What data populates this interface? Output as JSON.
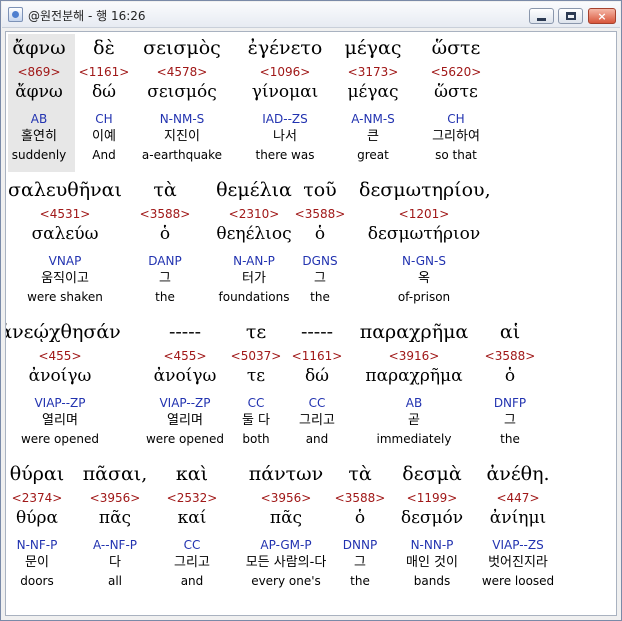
{
  "window": {
    "title": "@원전분해 - 행 16:26",
    "controls": {
      "minimize": "minimize",
      "maximize": "maximize",
      "close": "×"
    }
  },
  "verse": {
    "rows": [
      {
        "words": [
          {
            "word": "ἄφνω",
            "strong": "<869>",
            "lemma": "ἄφνω",
            "parse": "AB",
            "korean": "홀연히",
            "english": "suddenly"
          },
          {
            "word": "δὲ",
            "strong": "<1161>",
            "lemma": "δώ",
            "parse": "CH",
            "korean": "이예",
            "english": "And"
          },
          {
            "word": "σεισμὸς",
            "strong": "<4578>",
            "lemma": "σεισμός",
            "parse": "N-NM-S",
            "korean": "지진이",
            "english": "a-earthquake"
          },
          {
            "word": "ἐγένετο",
            "strong": "<1096>",
            "lemma": "γίνομαι",
            "parse": "IAD--ZS",
            "korean": "나서",
            "english": "there was"
          },
          {
            "word": "μέγας",
            "strong": "<3173>",
            "lemma": "μέγας",
            "parse": "A-NM-S",
            "korean": "큰",
            "english": "great"
          },
          {
            "word": "ὥστε",
            "strong": "<5620>",
            "lemma": "ὥστε",
            "parse": "CH",
            "korean": "그리하여",
            "english": "so that"
          }
        ]
      },
      {
        "words": [
          {
            "word": "σαλευθῆναι",
            "strong": "<4531>",
            "lemma": "σαλεύω",
            "parse": "VNAP",
            "korean": "움직이고",
            "english": "were shaken"
          },
          {
            "word": "τὰ",
            "strong": "<3588>",
            "lemma": "ὁ",
            "parse": "DANP",
            "korean": "그",
            "english": "the"
          },
          {
            "word": "θεμέλια",
            "strong": "<2310>",
            "lemma": "θεηέλιος",
            "parse": "N-AN-P",
            "korean": "터가",
            "english": "foundations"
          },
          {
            "word": "τοῦ",
            "strong": "<3588>",
            "lemma": "ὁ",
            "parse": "DGNS",
            "korean": "그",
            "english": "the"
          },
          {
            "word": "δεσμωτηρίου,",
            "strong": "<1201>",
            "lemma": "δεσμωτήριον",
            "parse": "N-GN-S",
            "korean": "옥",
            "english": "of-prison"
          }
        ]
      },
      {
        "words": [
          {
            "word": "ἀνεῴχθησάν",
            "strong": "<455>",
            "lemma": "ἀνοίγω",
            "parse": "VIAP--ZP",
            "korean": "열리며",
            "english": "were opened"
          },
          {
            "word": "-----",
            "strong": "<455>",
            "lemma": "ἀνοίγω",
            "parse": "VIAP--ZP",
            "korean": "열리며",
            "english": "were opened"
          },
          {
            "word": "τε",
            "strong": "<5037>",
            "lemma": "τε",
            "parse": "CC",
            "korean": "둘 다",
            "english": "both"
          },
          {
            "word": "-----",
            "strong": "<1161>",
            "lemma": "δώ",
            "parse": "CC",
            "korean": "그리고",
            "english": "and"
          },
          {
            "word": "παραχρῆμα",
            "strong": "<3916>",
            "lemma": "παραχρῆμα",
            "parse": "AB",
            "korean": "곧",
            "english": "immediately"
          },
          {
            "word": "αἱ",
            "strong": "<3588>",
            "lemma": "ὁ",
            "parse": "DNFP",
            "korean": "그",
            "english": "the"
          }
        ]
      },
      {
        "words": [
          {
            "word": "θύραι",
            "strong": "<2374>",
            "lemma": "θύρα",
            "parse": "N-NF-P",
            "korean": "문이",
            "english": "doors"
          },
          {
            "word": "πᾶσαι,",
            "strong": "<3956>",
            "lemma": "πᾶς",
            "parse": "A--NF-P",
            "korean": "다",
            "english": "all"
          },
          {
            "word": "καὶ",
            "strong": "<2532>",
            "lemma": "καί",
            "parse": "CC",
            "korean": "그리고",
            "english": "and"
          },
          {
            "word": "πάντων",
            "strong": "<3956>",
            "lemma": "πᾶς",
            "parse": "AP-GM-P",
            "korean": "모든 사람의-다",
            "english": "every one's"
          },
          {
            "word": "τὰ",
            "strong": "<3588>",
            "lemma": "ὁ",
            "parse": "DNNP",
            "korean": "그",
            "english": "the"
          },
          {
            "word": "δεσμὰ",
            "strong": "<1199>",
            "lemma": "δεσμόν",
            "parse": "N-NN-P",
            "korean": "매인 것이",
            "english": "bands"
          },
          {
            "word": "ἀνέθη.",
            "strong": "<447>",
            "lemma": "ἀνίημι",
            "parse": "VIAP--ZS",
            "korean": "벗어진지라",
            "english": "were loosed"
          }
        ]
      }
    ]
  }
}
